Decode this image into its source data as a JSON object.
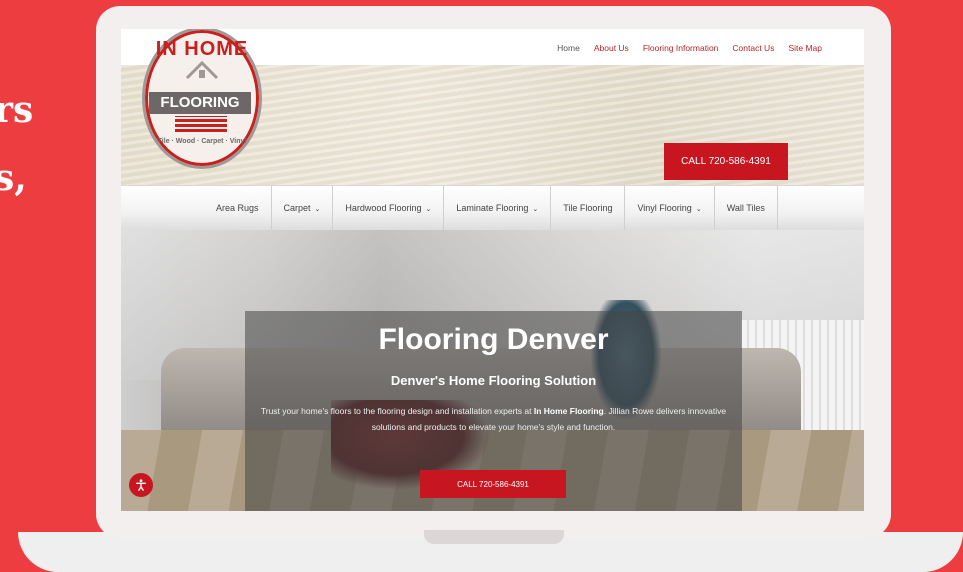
{
  "side_text": {
    "line1": "rs",
    "line2": "s,"
  },
  "top_nav": {
    "items": [
      {
        "label": "Home"
      },
      {
        "label": "About Us"
      },
      {
        "label": "Flooring Information"
      },
      {
        "label": "Contact Us"
      },
      {
        "label": "Site Map"
      }
    ]
  },
  "logo": {
    "ring_text": "IN HOME",
    "banner": "FLOORING",
    "tagline": "Tile · Wood · Carpet · Vinyl"
  },
  "header": {
    "call_button": "CALL 720-586-4391"
  },
  "main_nav": {
    "items": [
      {
        "label": "Area Rugs",
        "dropdown": false
      },
      {
        "label": "Carpet",
        "dropdown": true
      },
      {
        "label": "Hardwood Flooring",
        "dropdown": true
      },
      {
        "label": "Laminate Flooring",
        "dropdown": true
      },
      {
        "label": "Tile Flooring",
        "dropdown": false
      },
      {
        "label": "Vinyl Flooring",
        "dropdown": true
      },
      {
        "label": "Wall Tiles",
        "dropdown": false
      }
    ],
    "chevron_icon": "chevron-down-icon"
  },
  "hero": {
    "title": "Flooring Denver",
    "subtitle": "Denver's Home Flooring Solution",
    "body_pre": "Trust your home's floors to the flooring design and installation experts at ",
    "body_bold": "In Home Flooring",
    "body_post": ". Jillian Rowe delivers innovative solutions and products to elevate your home's style and function.",
    "button": "CALL 720-586-4391"
  },
  "colors": {
    "brand_red": "#c7161f",
    "page_bg": "#ee3d40"
  },
  "accessibility": {
    "icon": "accessibility-icon"
  }
}
